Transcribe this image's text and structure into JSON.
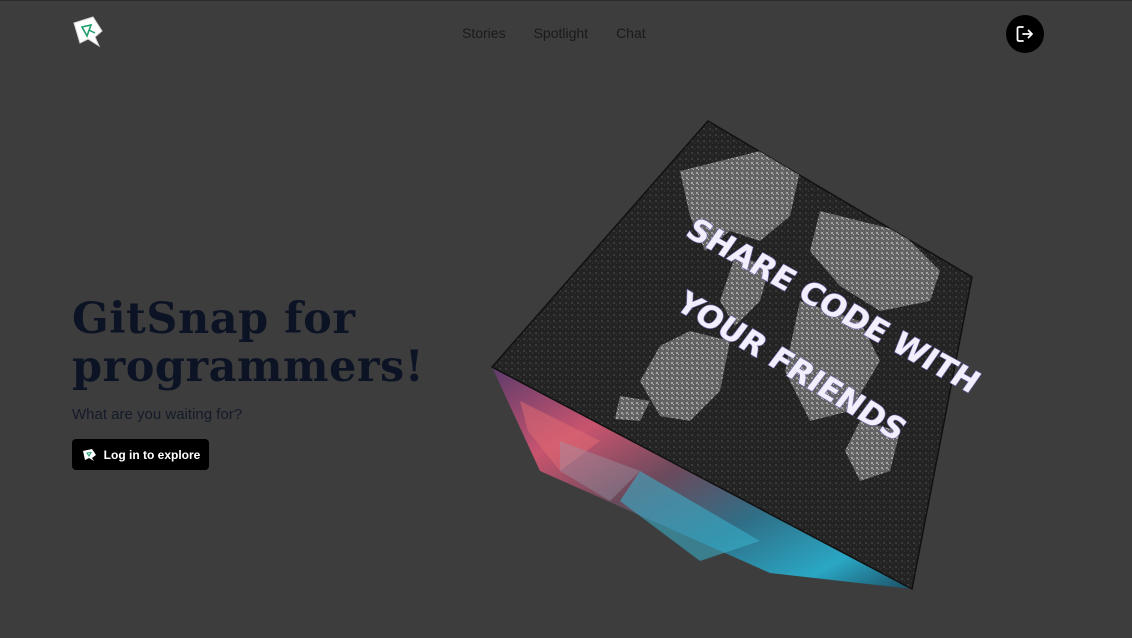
{
  "header": {
    "logo_icon": "gitsnap-logo-icon",
    "nav_items": [
      "Stories",
      "Spotlight",
      "Chat"
    ],
    "logout_icon": "logout-icon"
  },
  "hero": {
    "title_line1": "GitSnap for",
    "title_line2": "programmers!",
    "subtitle": "What are you waiting for?",
    "cta_label": "Log in to explore",
    "cta_icon": "snap-ghost-icon"
  },
  "cube": {
    "text_line1": "SHARE CODE WITH",
    "text_line2": "YOUR FRIENDS"
  },
  "colors": {
    "background": "#3d3d3d",
    "title": "#0c1324",
    "button": "#000000",
    "cube_text": "#f2eefc"
  }
}
